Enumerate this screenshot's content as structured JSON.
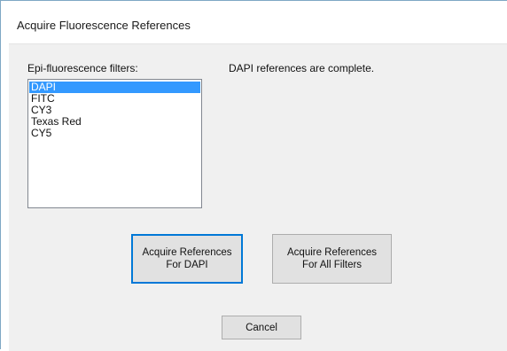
{
  "window": {
    "title": "Acquire Fluorescence References"
  },
  "filters": {
    "label": "Epi-fluorescence filters:",
    "items": [
      {
        "label": "DAPI",
        "selected": true
      },
      {
        "label": "FITC",
        "selected": false
      },
      {
        "label": "CY3",
        "selected": false
      },
      {
        "label": "Texas Red",
        "selected": false
      },
      {
        "label": "CY5",
        "selected": false
      }
    ]
  },
  "status": {
    "text": "DAPI references are complete."
  },
  "buttons": {
    "acquire_selected": {
      "line1": "Acquire References",
      "line2": "For DAPI"
    },
    "acquire_all": {
      "line1": "Acquire References",
      "line2": "For All Filters"
    },
    "cancel": "Cancel"
  },
  "colors": {
    "selection": "#3399ff",
    "default_button_border": "#0078d7",
    "dialog_background": "#f0f0f0"
  }
}
